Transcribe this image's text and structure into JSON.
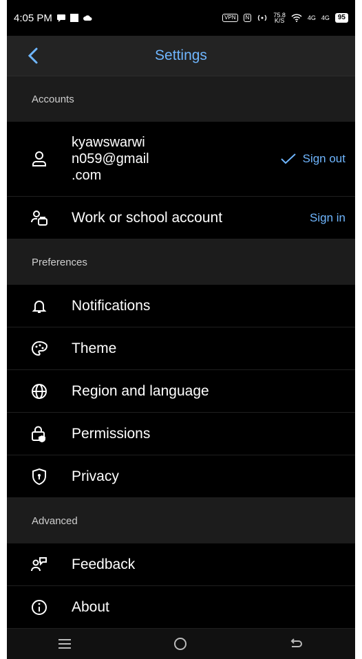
{
  "status_bar": {
    "time": "4:05 PM",
    "speed_value": "75.8",
    "speed_unit": "K/S",
    "net1": "4G",
    "net2": "4G",
    "battery": "95",
    "vpn_label": "VPN",
    "nfc_label": "N"
  },
  "header": {
    "title": "Settings"
  },
  "sections": {
    "accounts": "Accounts",
    "preferences": "Preferences",
    "advanced": "Advanced"
  },
  "accounts": {
    "personal": {
      "email_line1": "kyawswarwi",
      "email_line2": "n059@gmail",
      "email_line3": ".com",
      "action": "Sign out"
    },
    "work": {
      "label": "Work or school account",
      "action": "Sign in"
    }
  },
  "preferences": [
    {
      "label": "Notifications",
      "icon": "bell-icon"
    },
    {
      "label": "Theme",
      "icon": "palette-icon"
    },
    {
      "label": "Region and language",
      "icon": "globe-icon"
    },
    {
      "label": "Permissions",
      "icon": "lock-shield-icon"
    },
    {
      "label": "Privacy",
      "icon": "shield-icon"
    }
  ],
  "advanced": [
    {
      "label": "Feedback",
      "icon": "feedback-icon"
    },
    {
      "label": "About",
      "icon": "info-icon"
    }
  ],
  "colors": {
    "accent": "#6fb6ff",
    "background": "#000000",
    "section_bg": "#1c1c1c",
    "header_bg": "#232323"
  }
}
